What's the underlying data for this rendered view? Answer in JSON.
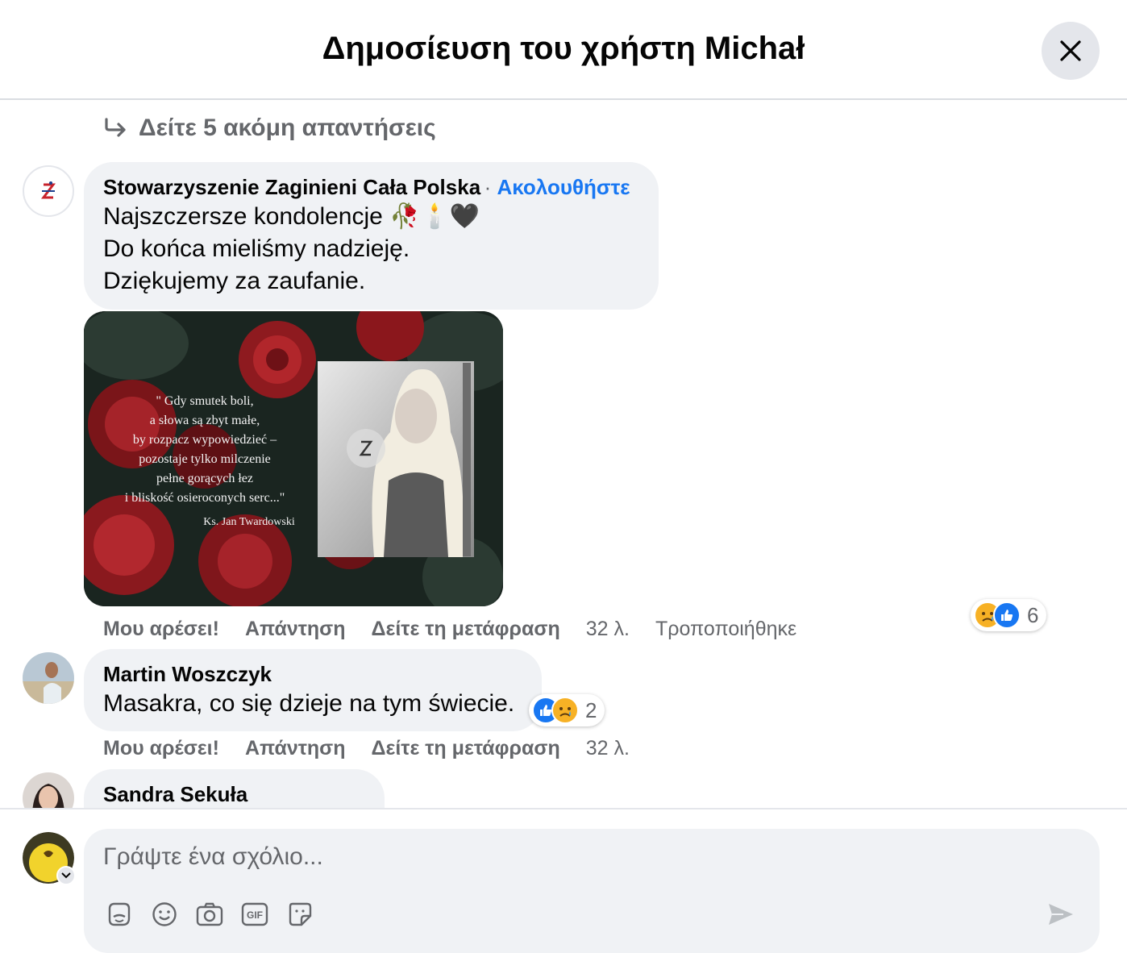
{
  "header": {
    "title": "Δημοσίευση του χρήστη Michał"
  },
  "more_replies": {
    "label": "Δείτε 5 ακόμη απαντήσεις"
  },
  "comments": [
    {
      "author": "Stowarzyszenie Zaginieni Cała Polska",
      "follow": "Ακολουθήστε",
      "lines": [
        "Najszczersze kondolencje 🥀🕯️🖤",
        "Do końca mieliśmy nadzieję.",
        "Dziękujemy za zaufanie."
      ],
      "image_quote": [
        "\" Gdy smutek boli,",
        "a słowa są zbyt małe,",
        "by rozpacz wypowiedzieć –",
        "pozostaje tylko milczenie",
        "pełne gorących łez",
        "i bliskość osieroconych serc...\""
      ],
      "image_attribution": "Ks. Jan Twardowski",
      "actions": {
        "like": "Μου αρέσει!",
        "reply": "Απάντηση",
        "translate": "Δείτε τη μετάφραση",
        "time": "32 λ.",
        "edited": "Τροποποιήθηκε"
      },
      "reaction_count": "6"
    },
    {
      "author": "Martin Woszczyk",
      "text": "Masakra, co się dzieje na tym świecie.",
      "actions": {
        "like": "Μου αρέσει!",
        "reply": "Απάντηση",
        "translate": "Δείτε τη μετάφραση",
        "time": "32 λ."
      },
      "reaction_count": "2"
    },
    {
      "author": "Sandra Sekuła"
    }
  ],
  "composer": {
    "placeholder": "Γράψτε ένα σχόλιο..."
  },
  "colors": {
    "link": "#1877f2",
    "bubble": "#f0f2f5",
    "secondary_text": "#65676b"
  }
}
